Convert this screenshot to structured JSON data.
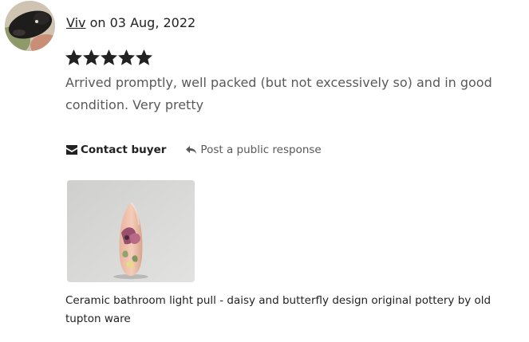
{
  "review": {
    "reviewer_name": "Viv",
    "date_prefix": " on ",
    "date": "03 Aug, 2022",
    "rating": 5,
    "rating_max": 5,
    "text": "Arrived promptly, well packed (but not excessively so) and in good condition. Very pretty"
  },
  "actions": {
    "contact_buyer_label": "Contact buyer",
    "contact_buyer_icon": "envelope-icon",
    "post_response_label": "Post a public response",
    "post_response_icon": "reply-arrow-icon"
  },
  "product": {
    "title": "Ceramic bathroom light pull - daisy and butterfly design original pottery by old tupton ware"
  },
  "colors": {
    "text_primary": "#222222",
    "text_secondary": "#595959",
    "star": "#222222"
  }
}
